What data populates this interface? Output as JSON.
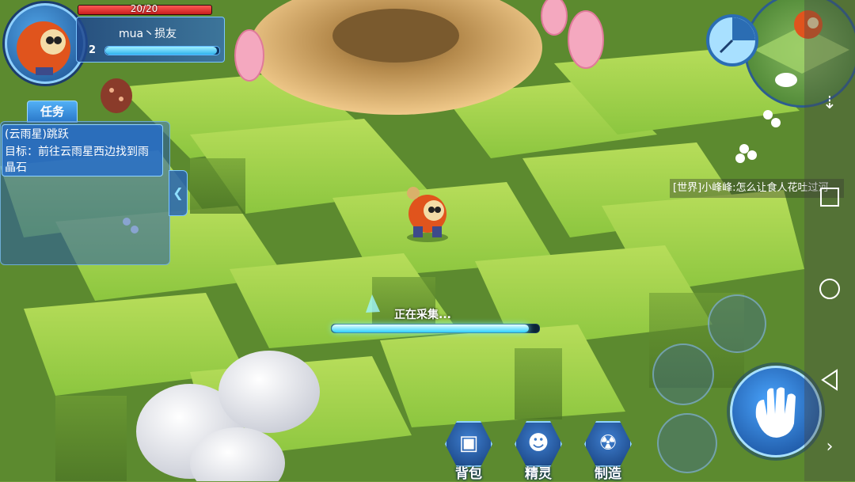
{
  "player": {
    "hp_text": "20/20",
    "hp_fraction": 1.0,
    "name": "mua丶损友",
    "level": "2",
    "exp_fraction": 0.98
  },
  "quest": {
    "tab_label": "任务",
    "title": "(云雨星)跳跃",
    "goal": "目标：前往云雨星西边找到雨晶石"
  },
  "chat": {
    "message": "[世界]小峰峰:怎么让食人花吐过河"
  },
  "gather": {
    "label": "正在采集...",
    "progress_fraction": 0.95
  },
  "menu": {
    "items": [
      {
        "label": "背包",
        "icon": "backpack-icon"
      },
      {
        "label": "精灵",
        "icon": "spirit-icon"
      },
      {
        "label": "制造",
        "icon": "crafting-icon"
      }
    ]
  },
  "colors": {
    "ui_blue": "#2b78c9",
    "hp_red": "#c81d1d",
    "exp_cyan": "#2fb2ee",
    "grass": "#8cc63f"
  }
}
